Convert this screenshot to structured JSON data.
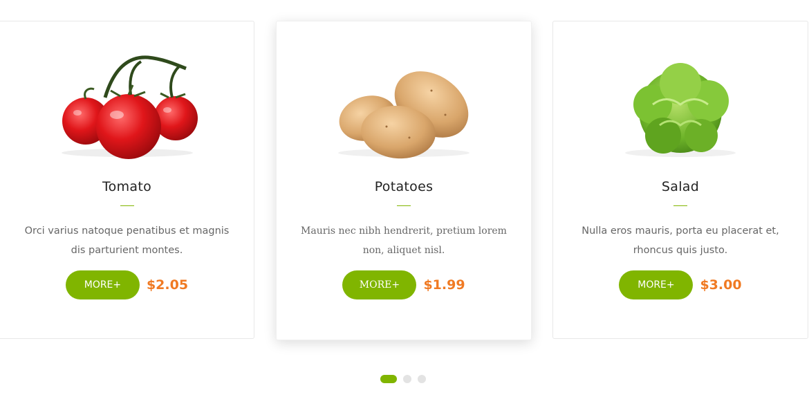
{
  "colors": {
    "accent": "#80b500",
    "price": "#f07a23",
    "text": "#222222",
    "muted": "#666666"
  },
  "products": [
    {
      "name": "Tomato",
      "image_icon": "tomato-image",
      "description": "Orci varius natoque penatibus et magnis dis parturient montes.",
      "button_label": "MORE+",
      "price": "$2.05"
    },
    {
      "name": "Potatoes",
      "image_icon": "potatoes-image",
      "description": "Mauris nec nibh hendrerit, pretium lorem non, aliquet nisl.",
      "button_label": "MORE+",
      "price": "$1.99"
    },
    {
      "name": "Salad",
      "image_icon": "salad-image",
      "description": "Nulla eros mauris, porta eu placerat et, rhoncus quis justo.",
      "button_label": "MORE+",
      "price": "$3.00"
    }
  ],
  "pagination": {
    "total": 3,
    "active": 1
  }
}
